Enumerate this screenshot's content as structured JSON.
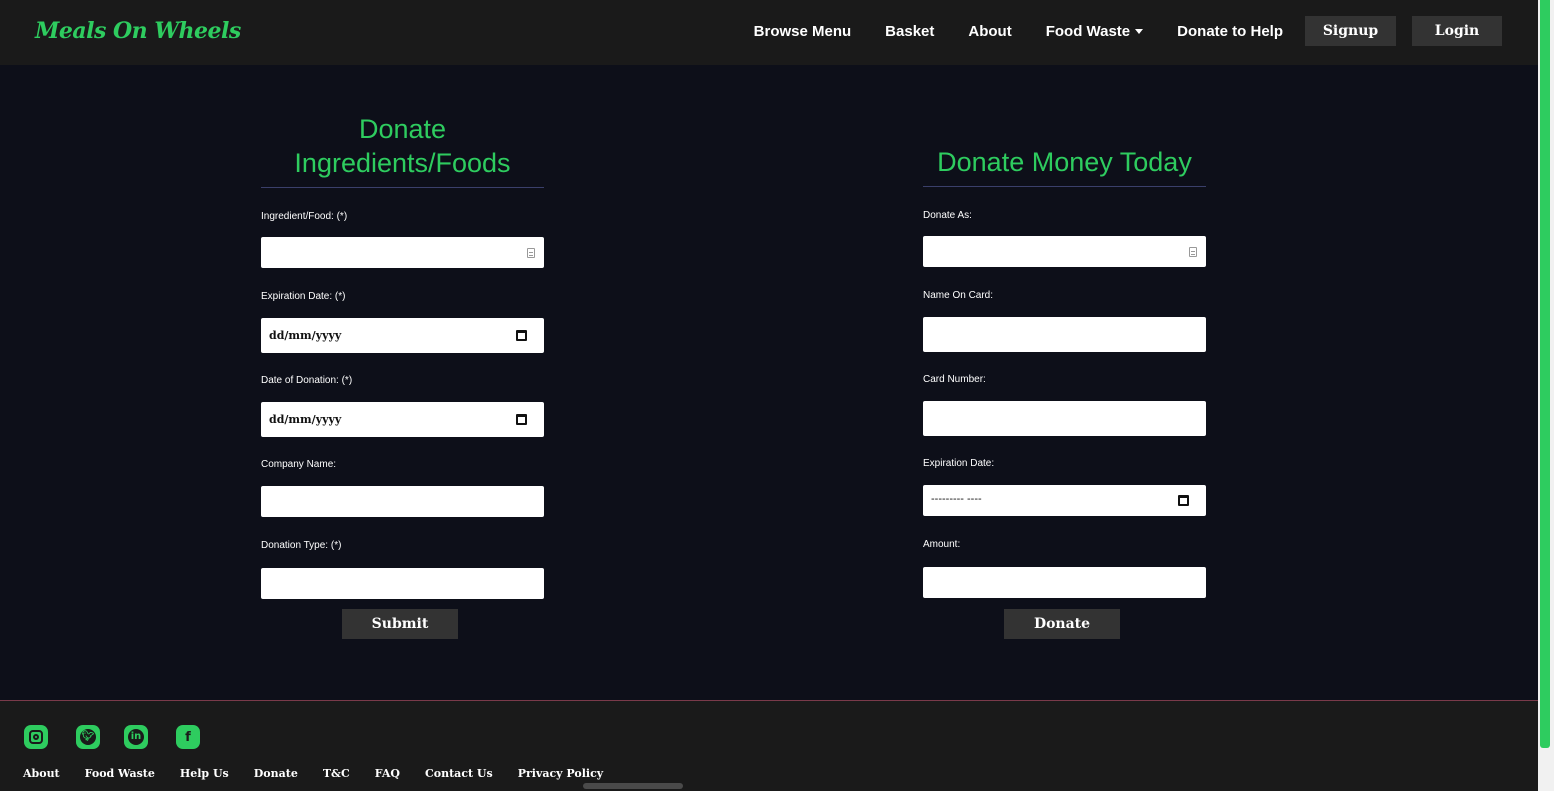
{
  "nav": {
    "brand": "Meals On Wheels",
    "links": [
      "Browse Menu",
      "Basket",
      "About",
      "Food Waste",
      "Donate to Help"
    ],
    "signup": "Signup",
    "login": "Login"
  },
  "food_form": {
    "title_line1": "Donate",
    "title_line2": "Ingredients/Foods",
    "fields": [
      {
        "label": "Ingredient/Food: (*)",
        "value": ""
      },
      {
        "label": "Expiration Date: (*)",
        "placeholder": "dd/mm/yyyy"
      },
      {
        "label": "Date of Donation: (*)",
        "placeholder": "dd/mm/yyyy"
      },
      {
        "label": "Company Name:",
        "value": ""
      },
      {
        "label": "Donation Type: (*)",
        "value": ""
      }
    ],
    "submit": "Submit"
  },
  "money_form": {
    "title": "Donate Money Today",
    "fields": [
      {
        "label": "Donate As:",
        "value": ""
      },
      {
        "label": "Name On Card:",
        "value": ""
      },
      {
        "label": "Card Number:",
        "value": ""
      },
      {
        "label": "Expiration Date:",
        "placeholder": "--------- ----"
      },
      {
        "label": "Amount:",
        "value": ""
      }
    ],
    "submit": "Donate"
  },
  "footer": {
    "social": [
      "instagram-icon",
      "twitter-icon",
      "linkedin-icon",
      "facebook-icon"
    ],
    "links": [
      "About",
      "Food Waste",
      "Help Us",
      "Donate",
      "T&C",
      "FAQ",
      "Contact Us",
      "Privacy Policy"
    ]
  },
  "colors": {
    "accent": "#2ecc5f",
    "background": "#0d0f19",
    "nav": "#1a1a1a"
  }
}
